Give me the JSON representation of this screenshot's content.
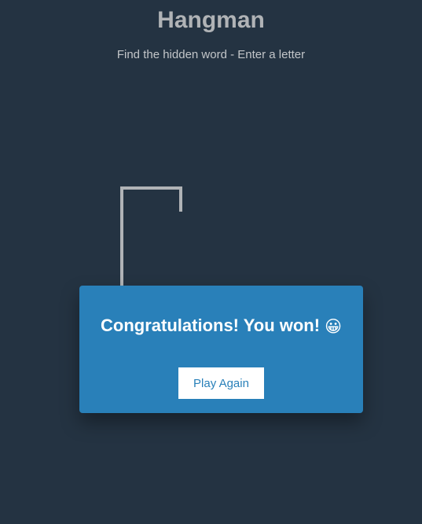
{
  "header": {
    "title": "Hangman",
    "subtitle": "Find the hidden word - Enter a letter"
  },
  "popup": {
    "message": "Congratulations! You won!",
    "emoji": "😀",
    "play_again_label": "Play Again"
  },
  "colors": {
    "background": "#243342",
    "popup": "#2980b9",
    "figure_line": "#b0b3b6"
  }
}
